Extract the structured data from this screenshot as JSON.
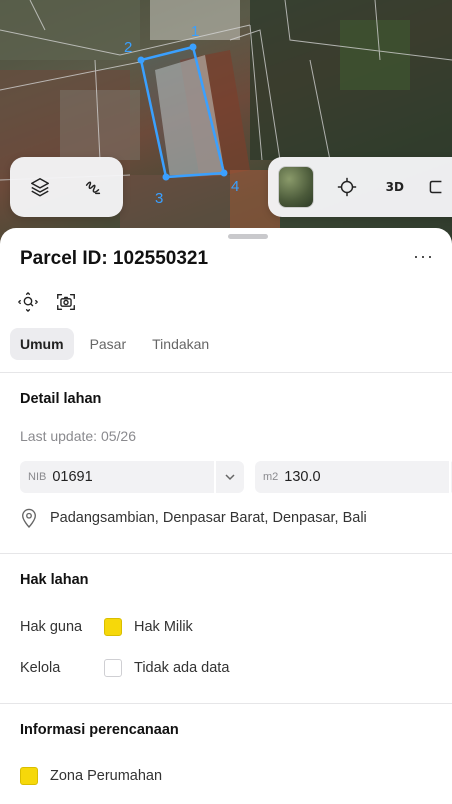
{
  "map": {
    "parcel_vertices": [
      "1",
      "2",
      "3",
      "4"
    ],
    "toolbar_left": {
      "layers_icon": "layers-icon",
      "draw_icon": "draw-gesture-icon"
    },
    "toolbar_right": {
      "basemap_icon": "satellite-thumbnail",
      "locate_icon": "crosshair-icon",
      "three_d_label": "3D",
      "edge_icon": "partial-square-icon"
    }
  },
  "parcel": {
    "title": "Parcel ID: 102550321",
    "more_label": "···",
    "actions": [
      "zoom-to-parcel-icon",
      "screenshot-icon"
    ]
  },
  "tabs": [
    "Umum",
    "Pasar",
    "Tindakan"
  ],
  "detail": {
    "heading": "Detail lahan",
    "last_update": "Last update: 05/26",
    "nib_label": "NIB",
    "nib_value": "01691",
    "area_label": "m2",
    "area_value": "130.0",
    "address": "Padangsambian, Denpasar Barat, Denpasar, Bali"
  },
  "hak": {
    "heading": "Hak lahan",
    "rows": [
      {
        "key": "Hak guna",
        "value": "Hak Milik",
        "color": "#f6d80a"
      },
      {
        "key": "Kelola",
        "value": "Tidak ada data",
        "color": "#ffffff"
      }
    ]
  },
  "planning": {
    "heading": "Informasi perencanaan",
    "zone": "Zona Perumahan",
    "zone_color": "#f6d80a"
  },
  "colors": {
    "parcel_outline": "#3aa0ff",
    "accent_yellow": "#f6d80a"
  }
}
